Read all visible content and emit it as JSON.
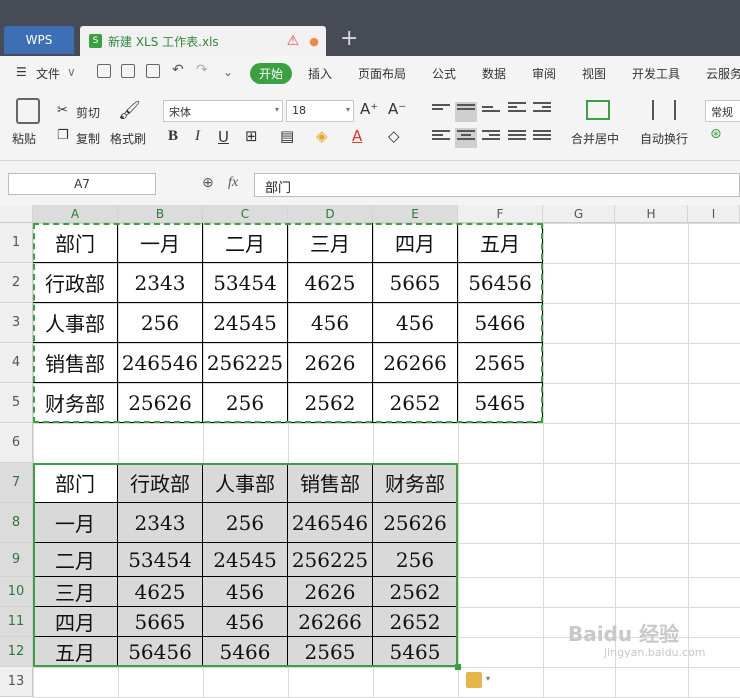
{
  "window": {
    "wps_tab": "WPS",
    "doc_tab": "新建 XLS 工作表.xls",
    "new_tab": "+"
  },
  "menu": {
    "file": "文件",
    "items": [
      "开始",
      "插入",
      "页面布局",
      "公式",
      "数据",
      "审阅",
      "视图",
      "开发工具",
      "云服务"
    ]
  },
  "toolbar": {
    "paste": "粘贴",
    "cut": "剪切",
    "copy": "复制",
    "format_painter": "格式刷",
    "font_name": "宋体",
    "font_size": "18",
    "merge_center": "合并居中",
    "wrap_text": "自动换行",
    "number_format": "常规"
  },
  "formula": {
    "cell_ref": "A7",
    "fx": "fx",
    "content": "部门"
  },
  "columns": [
    "A",
    "B",
    "C",
    "D",
    "E",
    "F",
    "G",
    "H",
    "I"
  ],
  "rows": [
    "1",
    "2",
    "3",
    "4",
    "5",
    "6",
    "7",
    "8",
    "9",
    "10",
    "11",
    "12",
    "13"
  ],
  "table1": [
    [
      "部门",
      "一月",
      "二月",
      "三月",
      "四月",
      "五月"
    ],
    [
      "行政部",
      "2343",
      "53454",
      "4625",
      "5665",
      "56456"
    ],
    [
      "人事部",
      "256",
      "24545",
      "456",
      "456",
      "5466"
    ],
    [
      "销售部",
      "246546",
      "256225",
      "2626",
      "26266",
      "2565"
    ],
    [
      "财务部",
      "25626",
      "256",
      "2562",
      "2652",
      "5465"
    ]
  ],
  "table2": [
    [
      "部门",
      "行政部",
      "人事部",
      "销售部",
      "财务部"
    ],
    [
      "一月",
      "2343",
      "256",
      "246546",
      "25626"
    ],
    [
      "二月",
      "53454",
      "24545",
      "256225",
      "256"
    ],
    [
      "三月",
      "4625",
      "456",
      "2626",
      "2562"
    ],
    [
      "四月",
      "5665",
      "456",
      "26266",
      "2652"
    ],
    [
      "五月",
      "56456",
      "5466",
      "2565",
      "5465"
    ]
  ],
  "watermark": {
    "main": "Baidu 经验",
    "sub": "jingyan.baidu.com"
  },
  "colors": {
    "accent": "#3aa142",
    "selection": "#2a7a37",
    "titlebar": "#474b55"
  }
}
